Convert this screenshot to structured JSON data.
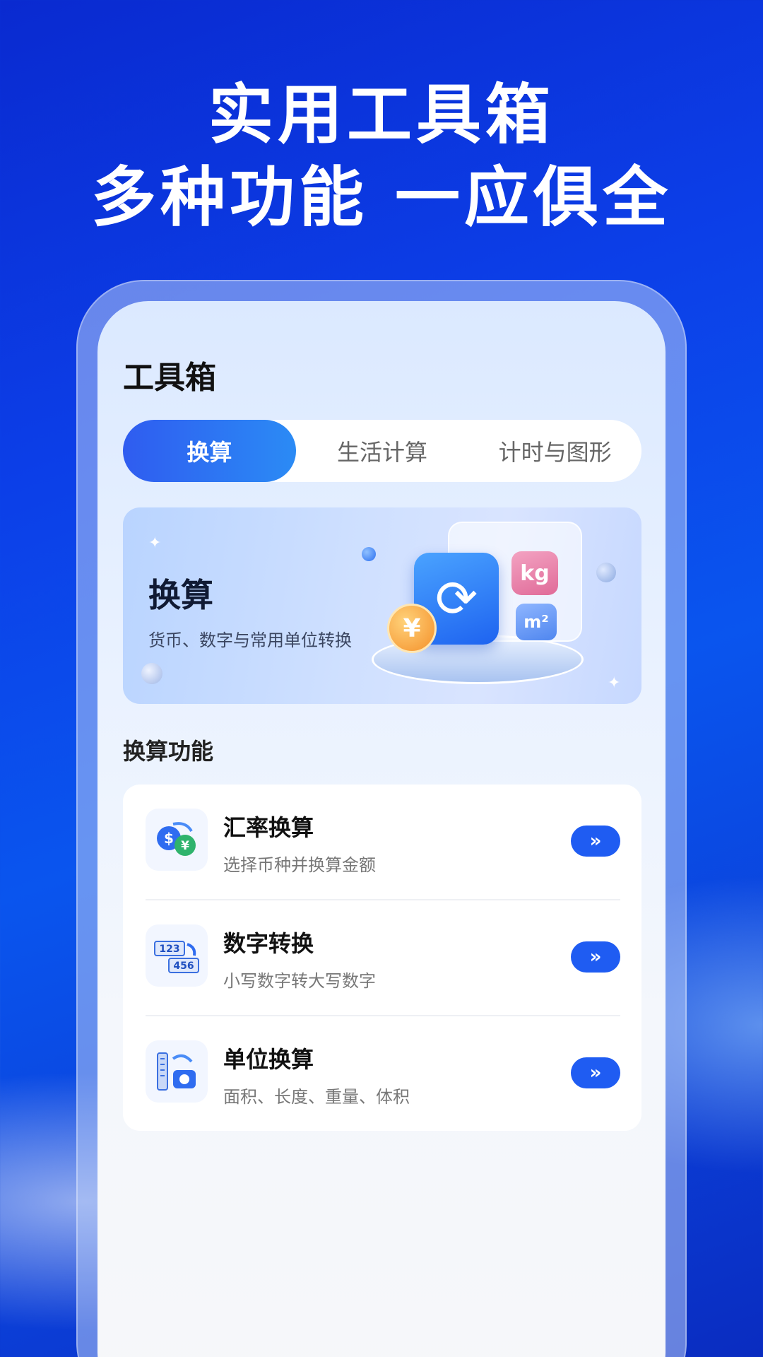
{
  "headline": {
    "line1": "实用工具箱",
    "line2": "多种功能 一应俱全"
  },
  "screen": {
    "title": "工具箱",
    "tabs": [
      {
        "label": "换算",
        "active": true
      },
      {
        "label": "生活计算",
        "active": false
      },
      {
        "label": "计时与图形",
        "active": false
      }
    ],
    "banner": {
      "title": "换算",
      "subtitle": "货币、数字与常用单位转换",
      "icons": [
        "refresh-icon",
        "kg-icon",
        "m2-icon",
        "yen-coin-icon"
      ],
      "kg_text": "kg",
      "m2_text": "m²",
      "yen_text": "¥"
    },
    "section_title": "换算功能",
    "items": [
      {
        "name": "汇率换算",
        "desc": "选择币种并换算金额",
        "icon": "currency-exchange-icon",
        "go": "»"
      },
      {
        "name": "数字转换",
        "desc": "小写数字转大写数字",
        "icon": "number-convert-icon",
        "go": "»"
      },
      {
        "name": "单位换算",
        "desc": "面积、长度、重量、体积",
        "icon": "unit-convert-icon",
        "go": "»"
      }
    ]
  },
  "colors": {
    "accent": "#1f5cf2",
    "background": "#0c3fe8"
  }
}
